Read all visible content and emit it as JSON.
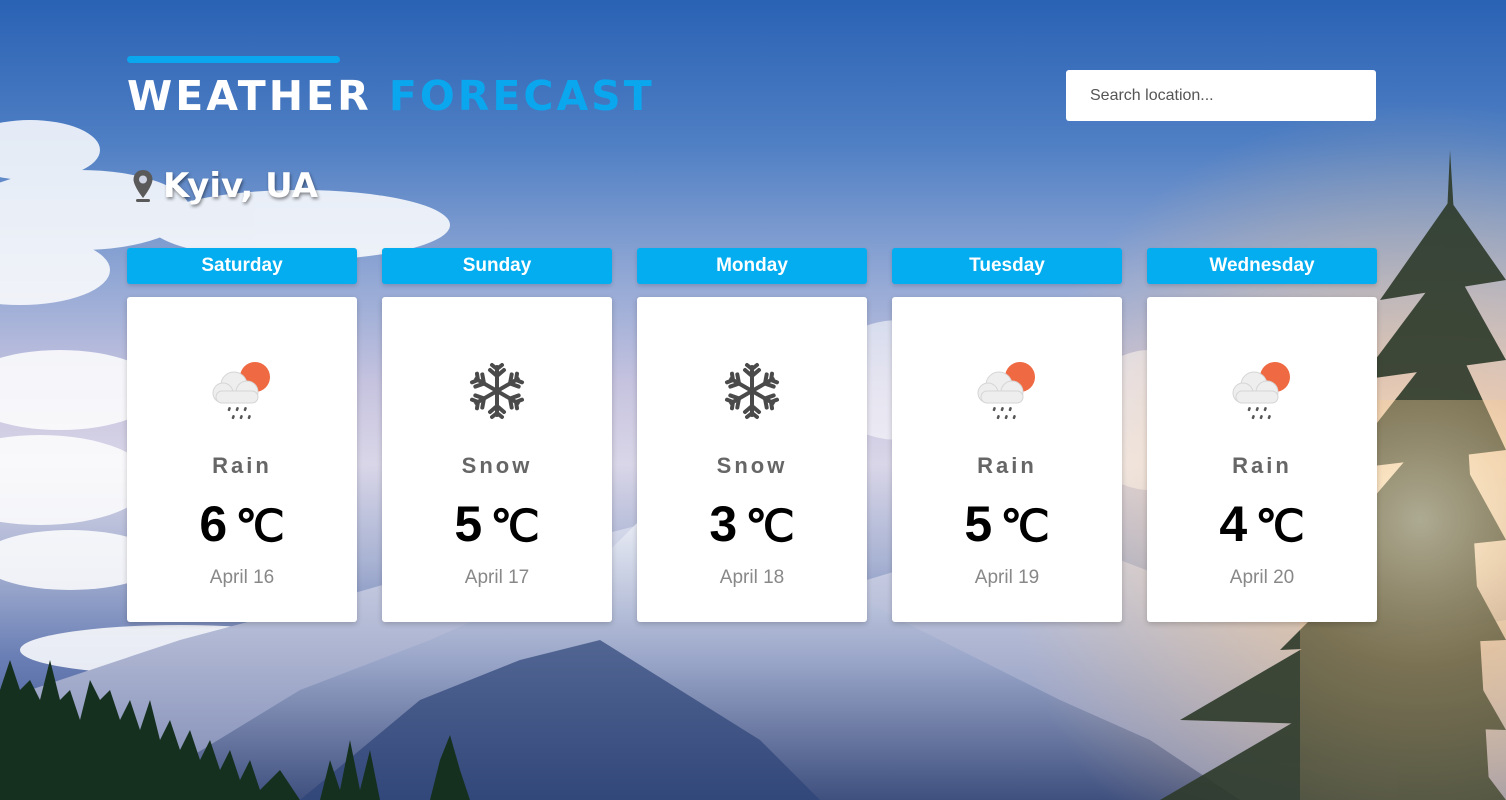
{
  "header": {
    "title_first": "WEATHER",
    "title_second": "FORECAST",
    "accent_color": "#0aa7ef"
  },
  "search": {
    "placeholder": "Search location...",
    "value": ""
  },
  "location": {
    "icon": "map-pin-icon",
    "name": "Kyiv, UA"
  },
  "forecast": [
    {
      "day": "Saturday",
      "icon": "rain-cloud-sun-icon",
      "condition": "Rain",
      "temp": "6",
      "unit": "℃",
      "date": "April 16"
    },
    {
      "day": "Sunday",
      "icon": "snowflake-icon",
      "condition": "Snow",
      "temp": "5",
      "unit": "℃",
      "date": "April 17"
    },
    {
      "day": "Monday",
      "icon": "snowflake-icon",
      "condition": "Snow",
      "temp": "3",
      "unit": "℃",
      "date": "April 18"
    },
    {
      "day": "Tuesday",
      "icon": "rain-cloud-sun-icon",
      "condition": "Rain",
      "temp": "5",
      "unit": "℃",
      "date": "April 19"
    },
    {
      "day": "Wednesday",
      "icon": "rain-cloud-sun-icon",
      "condition": "Rain",
      "temp": "4",
      "unit": "℃",
      "date": "April 20"
    }
  ],
  "colors": {
    "day_label_bg": "#03adef",
    "card_bg": "#ffffff",
    "condition_text": "#666666",
    "date_text": "#888888"
  }
}
